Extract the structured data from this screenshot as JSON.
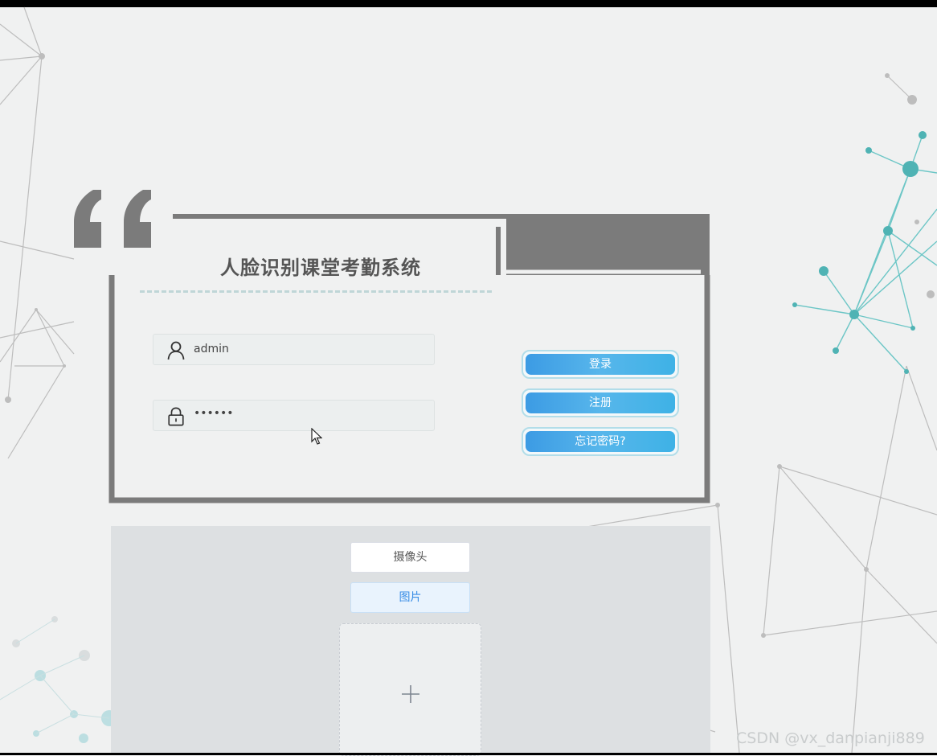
{
  "app": {
    "title": "人脸识别课堂考勤系统"
  },
  "login_form": {
    "username_value": "admin",
    "password_value": "••••••",
    "username_icon": "user-icon",
    "password_icon": "lock-icon"
  },
  "buttons": {
    "login_label": "登录",
    "register_label": "注册",
    "forgot_label": "忘记密码?"
  },
  "upload": {
    "camera_tab": "摄像头",
    "picture_tab": "图片",
    "upload_icon": "plus-icon"
  },
  "watermark": "CSDN @vx_danpianji889",
  "colors": {
    "background": "#f0f1f1",
    "frame": "#7b7b7b",
    "button_blue": "#4aa9e8",
    "accent_teal": "#4fb3b4"
  }
}
